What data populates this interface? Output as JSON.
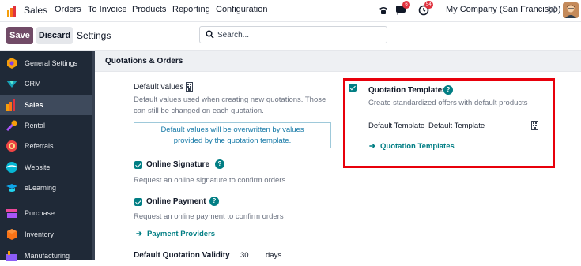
{
  "topbar": {
    "app_name": "Sales",
    "menu": [
      "Orders",
      "To Invoice",
      "Products",
      "Reporting",
      "Configuration"
    ],
    "messages_badge": "6",
    "activity_badge": "54",
    "company": "My Company (San Francisco)"
  },
  "controlbar": {
    "save_label": "Save",
    "discard_label": "Discard",
    "title": "Settings",
    "search_placeholder": "Search..."
  },
  "sidebar": {
    "items": [
      {
        "label": "General Settings",
        "icon": "general-settings-icon",
        "color": "#f59e0b"
      },
      {
        "label": "CRM",
        "icon": "crm-icon",
        "color": "#17a2b8"
      },
      {
        "label": "Sales",
        "icon": "sales-icon",
        "color": "#f97316",
        "active": true
      },
      {
        "label": "Rental",
        "icon": "rental-icon",
        "color": "#a855f7"
      },
      {
        "label": "Referrals",
        "icon": "referrals-icon",
        "color": "#ef4444"
      },
      {
        "label": "Website",
        "icon": "website-icon",
        "color": "#06b6d4"
      },
      {
        "label": "eLearning",
        "icon": "elearning-icon",
        "color": "#0ea5e9"
      },
      {
        "label": "Purchase",
        "icon": "purchase-icon",
        "color": "#ec4899"
      },
      {
        "label": "Inventory",
        "icon": "inventory-icon",
        "color": "#f97316"
      },
      {
        "label": "Manufacturing",
        "icon": "manufacturing-icon",
        "color": "#8b5cf6"
      }
    ]
  },
  "section": {
    "title": "Quotations & Orders",
    "default_values": {
      "label": "Default values",
      "desc1": "Default values used when creating new quotations. Those",
      "desc2": "can still be changed on each quotation.",
      "alert1": "Default values will be overwritten by values",
      "alert2": "provided by the quotation template."
    },
    "online_signature": {
      "label": "Online Signature",
      "desc": "Request an online signature to confirm orders"
    },
    "online_payment": {
      "label": "Online Payment",
      "desc": "Request an online payment to confirm orders",
      "link": "Payment Providers"
    },
    "validity": {
      "label": "Default Quotation Validity",
      "value": "30",
      "unit": "days"
    },
    "quotation_templates": {
      "label": "Quotation Templates",
      "desc": "Create standardized offers with default products",
      "field_label": "Default Template",
      "field_value": "Default Template",
      "link": "Quotation Templates"
    }
  }
}
